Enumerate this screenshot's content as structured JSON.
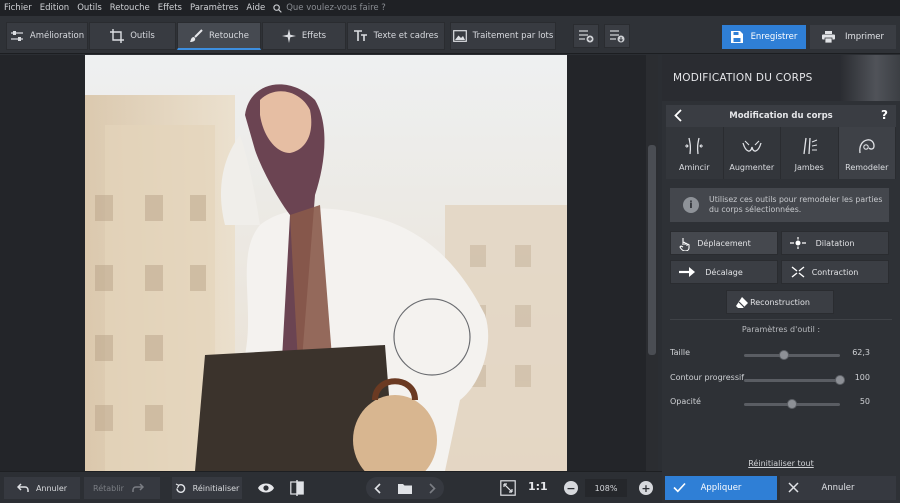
{
  "menu": {
    "items": [
      "Fichier",
      "Edition",
      "Outils",
      "Retouche",
      "Effets",
      "Paramètres",
      "Aide"
    ],
    "search_placeholder": "Que voulez-vous faire ?"
  },
  "toolbar": {
    "tabs": [
      {
        "label": "Amélioration",
        "icon": "sliders-icon"
      },
      {
        "label": "Outils",
        "icon": "crop-icon"
      },
      {
        "label": "Retouche",
        "icon": "brush-icon",
        "active": true
      },
      {
        "label": "Effets",
        "icon": "sparkle-icon"
      },
      {
        "label": "Texte et cadres",
        "icon": "text-icon"
      },
      {
        "label": "Traitement par lots",
        "icon": "image-icon"
      }
    ],
    "save_label": "Enregistrer",
    "print_label": "Imprimer"
  },
  "panel": {
    "title": "MODIFICATION DU CORPS",
    "subtitle": "Modification du corps",
    "help": "?",
    "tool_tabs": [
      {
        "label": "Amincir",
        "icon": "slim-icon"
      },
      {
        "label": "Augmenter",
        "icon": "enlarge-icon"
      },
      {
        "label": "Jambes",
        "icon": "legs-icon"
      },
      {
        "label": "Remodeler",
        "icon": "reshape-icon",
        "active": true
      }
    ],
    "info_icon": "i",
    "info_text": "Utilisez ces outils pour remodeler les parties du corps sélectionnées.",
    "tools": {
      "deplacement": "Déplacement",
      "dilatation": "Dilatation",
      "decalage": "Décalage",
      "contraction": "Contraction",
      "reconstruction": "Reconstruction"
    },
    "params_label": "Paramètres d'outil :",
    "params": [
      {
        "label": "Taille",
        "value": "62,3",
        "level": 0.42
      },
      {
        "label": "Contour progressif",
        "value": "100",
        "level": 1.0
      },
      {
        "label": "Opacité",
        "value": "50",
        "level": 0.5
      }
    ],
    "reset_all": "Réinitialiser tout"
  },
  "bottom": {
    "undo": "Annuler",
    "redo": "Rétablir",
    "reset": "Réinitialiser",
    "one_to_one": "1:1",
    "zoom_minus": "−",
    "zoom": "108%",
    "zoom_plus": "+",
    "apply": "Appliquer",
    "cancel": "Annuler"
  },
  "colors": {
    "accent": "#2f7fd6",
    "panel_bg": "#2e3136",
    "toolbar_bg": "#2f3237"
  }
}
